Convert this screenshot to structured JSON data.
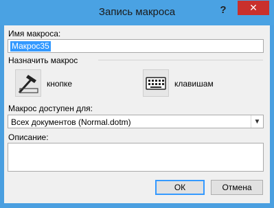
{
  "window": {
    "title": "Запись макроса",
    "help_label": "?",
    "close_label": "✕"
  },
  "macro_name": {
    "label": "Имя макроса:",
    "value": "Макрос35"
  },
  "assign": {
    "label": "Назначить макрос",
    "button_label": "кнопке",
    "keyboard_label": "клавишам"
  },
  "available": {
    "label": "Макрос доступен для:",
    "selected": "Всех документов (Normal.dotm)"
  },
  "description": {
    "label": "Описание:",
    "value": ""
  },
  "footer": {
    "ok_label": "ОК",
    "cancel_label": "Отмена"
  }
}
